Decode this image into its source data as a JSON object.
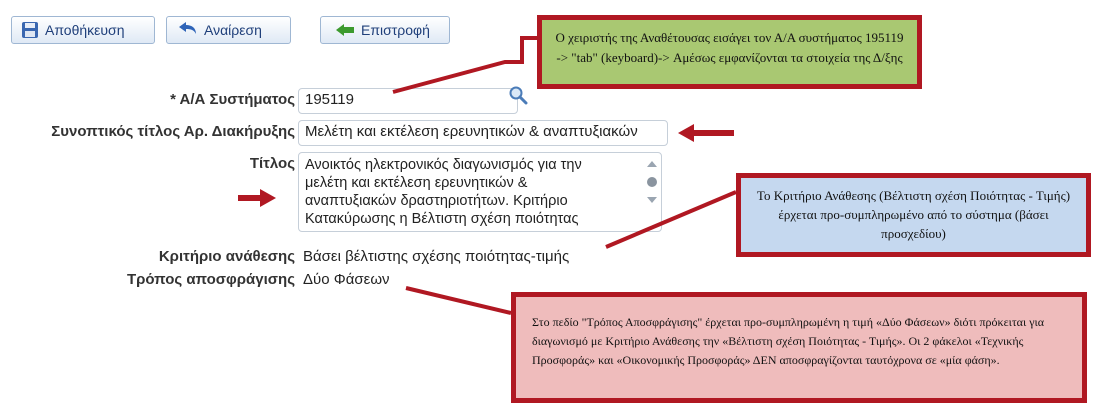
{
  "toolbar": {
    "save_label": "Αποθήκευση",
    "undo_label": "Αναίρεση",
    "back_label": "Επιστροφή"
  },
  "form": {
    "system_id_label": "* Α/Α Συστήματος",
    "system_id_value": "195119",
    "short_title_label": "Συνοπτικός τίτλος Αρ. Διακήρυξης",
    "short_title_value": "Μελέτη και εκτέλεση ερευνητικών & αναπτυξιακών",
    "title_label": "Τίτλος",
    "title_value": "Ανοικτός ηλεκτρονικός διαγωνισμός για την\nμελέτη και εκτέλεση ερευνητικών &\nαναπτυξιακών δραστηριοτήτων. Κριτήριο\nΚατακύρωσης η Βέλτιστη σχέση ποιότητας",
    "criterion_label": "Κριτήριο ανάθεσης",
    "criterion_value": "Βάσει βέλτιστης σχέσης ποιότητας-τιμής",
    "unsealing_label": "Τρόπος αποσφράγισης",
    "unsealing_value": "Δύο Φάσεων"
  },
  "annotations": {
    "green": "Ο χειριστής της Αναθέτουσας εισάγει τον Α/Α συστήματος 195119 -> \"tab\" (keyboard)-> Αμέσως εμφανίζονται τα στοιχεία της Δ/ξης",
    "blue": "Το Κριτήριο Ανάθεσης (Βέλτιστη σχέση Ποιότητας - Τιμής) έρχεται προ-συμπληρωμένο από το σύστημα (βάσει προσχεδίου)",
    "red": "Στο πεδίο \"Τρόπος Αποσφράγισης\" έρχεται προ-συμπληρωμένη η τιμή «Δύο Φάσεων» διότι πρόκειται για διαγωνισμό με Κριτήριο Ανάθεσης την «Βέλτιστη σχέση Ποιότητας - Τιμής». Οι 2 φάκελοι «Τεχνικής Προσφοράς» και «Οικονομικής Προσφοράς» ΔΕΝ αποσφραγίζονται ταυτόχρονα σε «μία φάση»."
  },
  "colors": {
    "annotation_border": "#b01822",
    "green_note": "#a9c872",
    "blue_note": "#c5d8ef",
    "red_note": "#efbcbc",
    "button_text": "#1f3f7a"
  },
  "icons": [
    "save-icon",
    "undo-icon",
    "back-arrow-icon",
    "search-icon",
    "scroll-up-icon",
    "scroll-down-icon"
  ]
}
